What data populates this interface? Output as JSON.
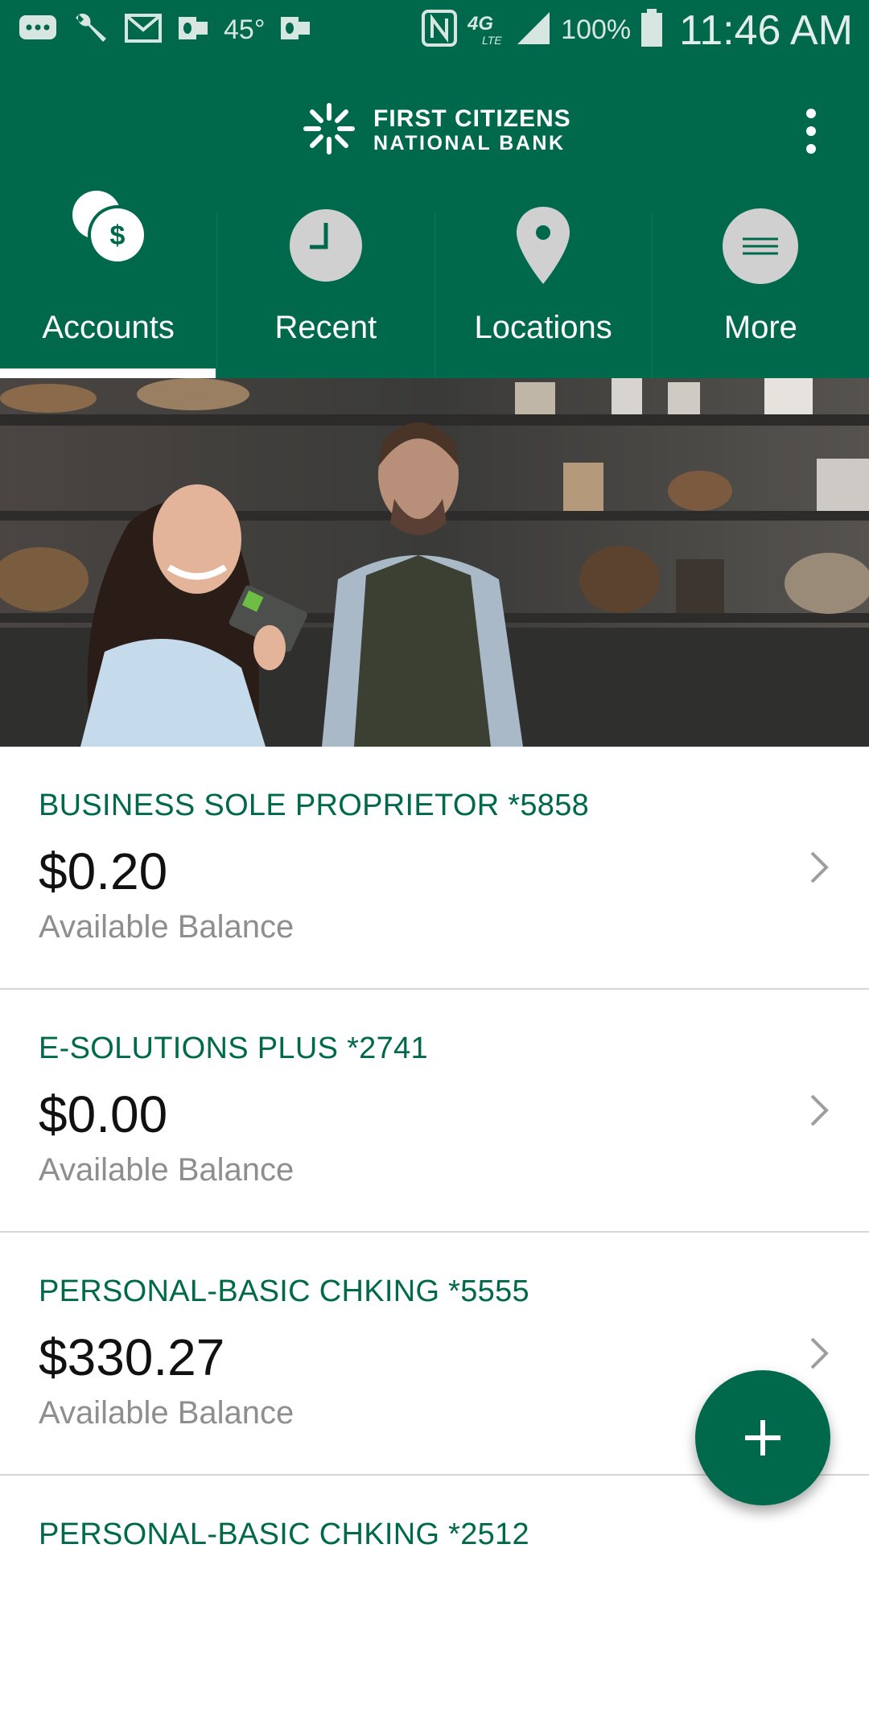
{
  "status_bar": {
    "temperature": "45°",
    "network": "4G LTE",
    "battery": "100%",
    "time": "11:46 AM",
    "icons": [
      "messages-icon",
      "wrench-icon",
      "gmail-icon",
      "outlook-icon",
      "outlook-icon",
      "nfc-icon",
      "signal-icon",
      "battery-icon"
    ]
  },
  "header": {
    "logo_line1": "FIRST CITIZENS",
    "logo_line2": "NATIONAL BANK",
    "menu_icon": "kebab-menu-icon"
  },
  "tabs": [
    {
      "label": "Accounts",
      "icon": "accounts-coins-icon",
      "selected": true
    },
    {
      "label": "Recent",
      "icon": "clock-icon",
      "selected": false
    },
    {
      "label": "Locations",
      "icon": "map-pin-icon",
      "selected": false
    },
    {
      "label": "More",
      "icon": "menu-lines-icon",
      "selected": false
    }
  ],
  "accounts": [
    {
      "name": "BUSINESS SOLE PROPRIETOR *5858",
      "balance": "$0.20",
      "balance_label": "Available Balance"
    },
    {
      "name": "E-SOLUTIONS PLUS *2741",
      "balance": "$0.00",
      "balance_label": "Available Balance"
    },
    {
      "name": "PERSONAL-BASIC CHKING *5555",
      "balance": "$330.27",
      "balance_label": "Available Balance"
    },
    {
      "name": "PERSONAL-BASIC CHKING *2512",
      "balance": "",
      "balance_label": ""
    }
  ],
  "fab": {
    "icon": "plus-icon"
  },
  "colors": {
    "brand": "#00694c",
    "account_name": "#00694c",
    "muted": "#8e8e8e"
  }
}
